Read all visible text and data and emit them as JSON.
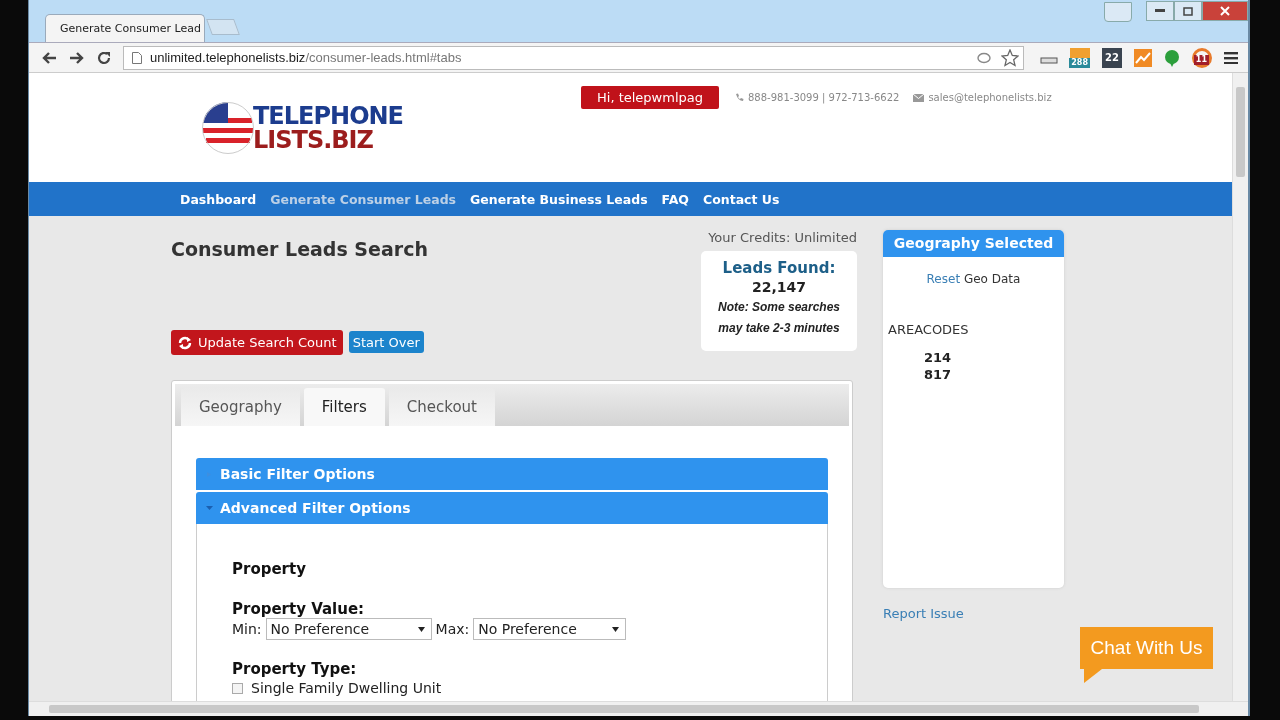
{
  "browser": {
    "tab_title": "Generate Consumer Lead",
    "url_host": "unlimited.telephonelists.biz",
    "url_path": "/consumer-leads.html#tabs",
    "badges": [
      "288",
      "22",
      "11"
    ]
  },
  "header": {
    "logo_lines": [
      "TELEPHONE",
      "LISTS.BIZ"
    ],
    "user_button": "Hi, telepwmlpag",
    "phones": "888-981-3099 | 972-713-6622",
    "email": "sales@telephonelists.biz"
  },
  "nav": [
    {
      "label": "Dashboard",
      "selected": false
    },
    {
      "label": "Generate Consumer Leads",
      "selected": true
    },
    {
      "label": "Generate Business Leads",
      "selected": false
    },
    {
      "label": "FAQ",
      "selected": false
    },
    {
      "label": "Contact Us",
      "selected": false
    }
  ],
  "main": {
    "title": "Consumer Leads Search",
    "credits": "Your Credits: Unlimited",
    "leads_label": "Leads Found:",
    "leads_count": "22,147",
    "note": "Note: Some searches may take 2-3 minutes",
    "update_button": "Update Search Count",
    "start_over_button": "Start Over"
  },
  "tabs": [
    {
      "label": "Geography",
      "selected": false
    },
    {
      "label": "Filters",
      "selected": true
    },
    {
      "label": "Checkout",
      "selected": false
    }
  ],
  "accordion": [
    {
      "title": "Basic Filter Options",
      "expanded": false
    },
    {
      "title": "Advanced Filter Options",
      "expanded": true
    }
  ],
  "filters": {
    "section": "Property",
    "value_label": "Property Value:",
    "min_label": "Min:",
    "min_value": "No Preference",
    "max_label": "Max:",
    "max_value": "No Preference",
    "type_label": "Property Type:",
    "options": [
      {
        "label": "Single Family Dwelling Unit",
        "checked": false
      }
    ]
  },
  "sidebar": {
    "header": "Geography Selected",
    "reset_link": "Reset",
    "reset_text": "Geo Data",
    "areacodes_label": "AREACODES",
    "areacodes": [
      "214",
      "817"
    ],
    "report_link": "Report Issue"
  },
  "chat": "Chat With Us"
}
